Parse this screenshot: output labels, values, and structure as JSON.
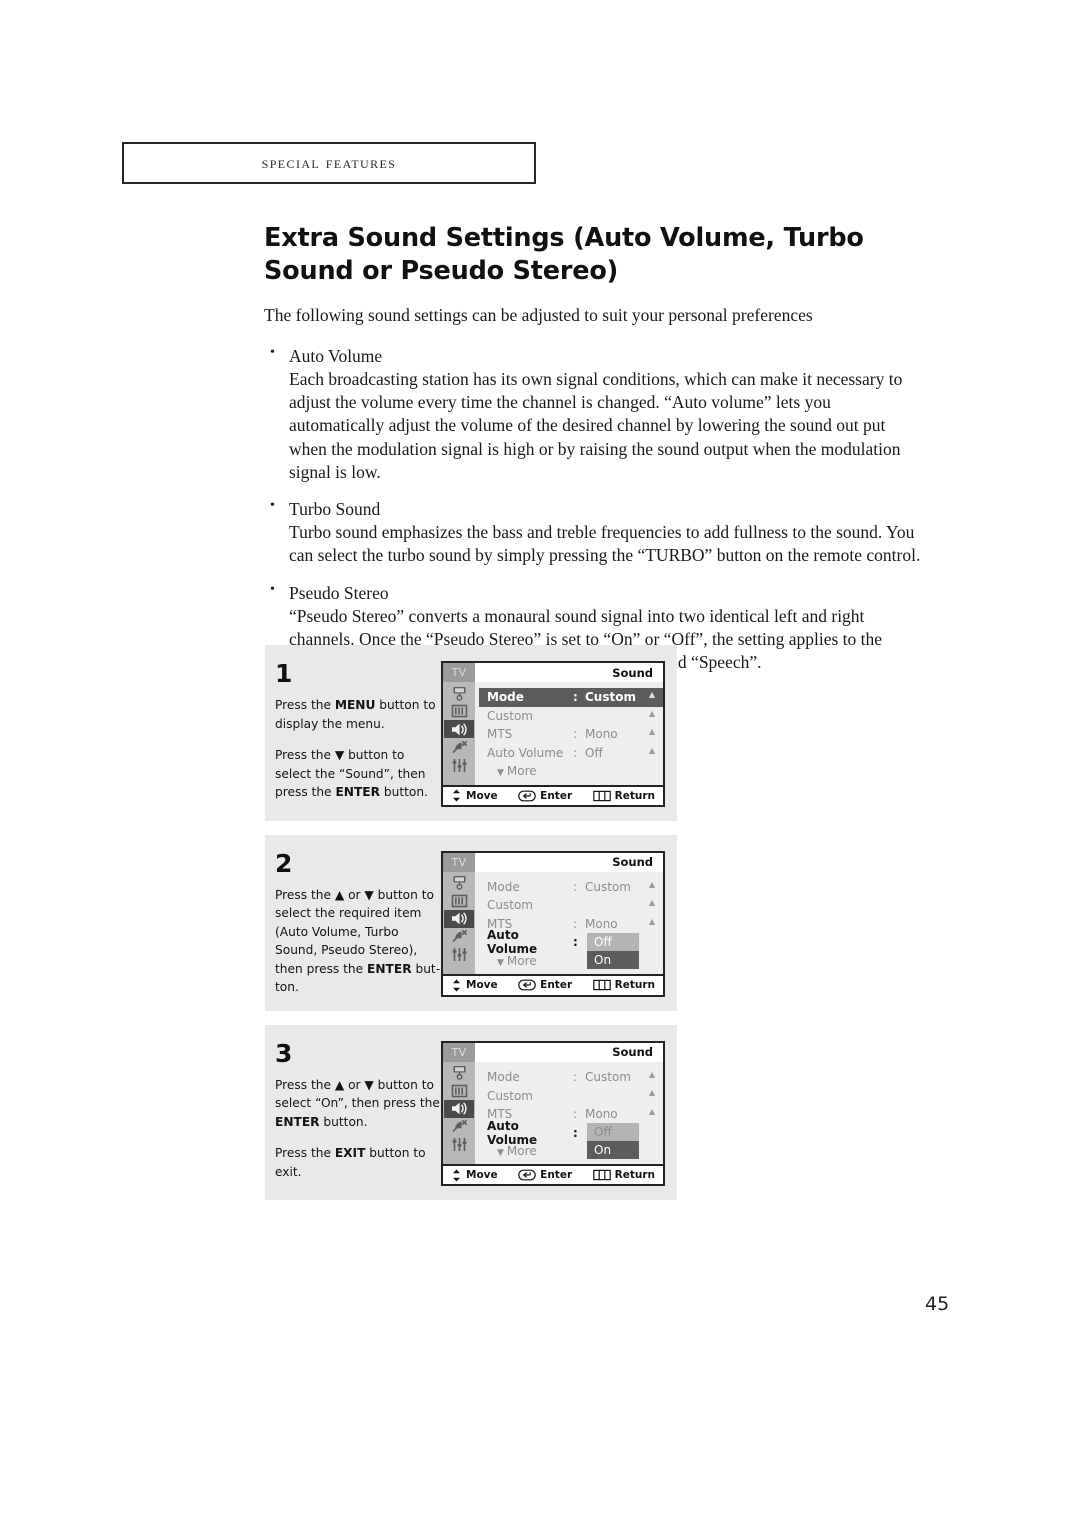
{
  "running_head": "Special Features",
  "page_number": "45",
  "article": {
    "title": "Extra Sound Settings (Auto Volume, Turbo Sound or Pseudo Stereo)",
    "lead": "The following sound settings can be adjusted to suit your personal preferences",
    "bullets": [
      {
        "heading": "Auto Volume",
        "body": "Each broadcasting station has its own signal conditions, which can make it necessary to adjust the volume every time the channel is changed. “Auto volume” lets you automatically adjust the volume of the desired channel by lowering the sound out put when the modulation signal is high or by raising the sound output when the modulation signal is low."
      },
      {
        "heading": "Turbo Sound",
        "body": "Turbo sound emphasizes the bass and treble frequencies to add fullness to the sound. You can select the turbo sound by simply pressing the “TURBO” button on the remote control."
      },
      {
        "heading": "Pseudo Stereo",
        "body": "“Pseudo Stereo” converts a monaural sound signal into two identical left and right channels. Once the “Pseudo Stereo” is set to “On” or “Off”, the setting applies to the sound effects such as “Standard”, “Music”, “Movie” and “Speech”."
      }
    ]
  },
  "steps": [
    {
      "number": "1",
      "line1_a": "Press the ",
      "line1_b": "MENU",
      "line1_c": " button to display the menu.",
      "line2_a": "Press the ▼ button to select the “Sound”, then press the ",
      "line2_b": "ENTER",
      "line2_c": " button."
    },
    {
      "number": "2",
      "line1_a": "Press the ▲ or ▼ button to select the required item (Auto Volume, Turbo Sound, Pseudo Stereo), then press the ",
      "line1_b": "ENTER",
      "line1_c": " but-ton.",
      "line2_a": "",
      "line2_b": "",
      "line2_c": ""
    },
    {
      "number": "3",
      "line1_a": "Press the ▲ or ▼ button to select “On”, then press the ",
      "line1_b": "ENTER",
      "line1_c": " button.",
      "line2_a": "Press the ",
      "line2_b": "EXIT",
      "line2_c": " button to exit."
    }
  ],
  "osd": {
    "tv_tag": "TV",
    "title": "Sound",
    "rail_icons": [
      "input-icon",
      "picture-icon",
      "sound-icon",
      "channel-icon",
      "setup-icon"
    ],
    "rows": {
      "mode_label": "Mode",
      "mode_value": "Custom",
      "custom_label": "Custom",
      "mts_label": "MTS",
      "mts_value": "Mono",
      "auto_volume_label": "Auto Volume",
      "auto_volume_value": "Off",
      "more_label": "More",
      "colon": ":"
    },
    "dropdown": {
      "off": "Off",
      "on": "On"
    },
    "footer": {
      "move": "Move",
      "enter": "Enter",
      "return": "Return"
    }
  },
  "colors": {
    "panel_bg": "#e9e9e9",
    "osd_body": "#eeeeee",
    "osd_rail": "#b8b8b8",
    "highlight_dark": "#5c5c5c",
    "highlight_light": "#b4b4b4",
    "dim_text": "#8d8d8d"
  }
}
